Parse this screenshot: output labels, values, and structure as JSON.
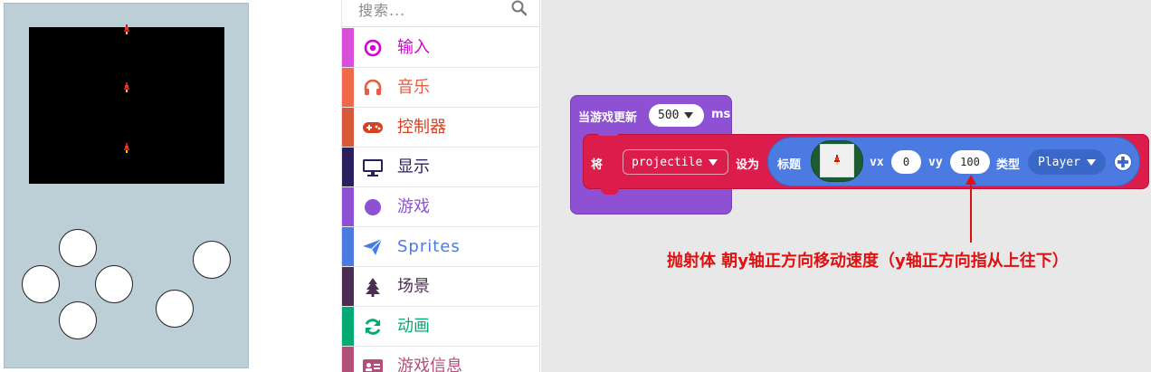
{
  "simulator": {
    "colors": {
      "screen": "#000000",
      "device": "#bccfd7"
    },
    "sprites": [
      {
        "icon": "rocket-sprite-icon"
      },
      {
        "icon": "rocket-sprite-icon"
      },
      {
        "icon": "rocket-sprite-icon"
      }
    ],
    "buttons": [
      "up",
      "left",
      "right",
      "down",
      "a",
      "b"
    ]
  },
  "toolbox": {
    "search_placeholder": "搜索...",
    "search_icon": "search-icon",
    "categories": [
      {
        "label": "输入",
        "color": "#d400d4",
        "icon": "target-icon"
      },
      {
        "label": "音乐",
        "color": "#e65c40",
        "icon": "headphones-icon"
      },
      {
        "label": "控制器",
        "color": "#d54322",
        "icon": "gamepad-icon"
      },
      {
        "label": "显示",
        "color": "#2b1f5e",
        "icon": "monitor-icon"
      },
      {
        "label": "游戏",
        "color": "#8f51d4",
        "icon": "circle-icon"
      },
      {
        "label": "Sprites",
        "color": "#4b7be0",
        "icon": "paper-plane-icon"
      },
      {
        "label": "场景",
        "color": "#4b2c52",
        "icon": "tree-icon"
      },
      {
        "label": "动画",
        "color": "#03aa74",
        "icon": "refresh-icon"
      },
      {
        "label": "游戏信息",
        "color": "#b34e78",
        "icon": "id-card-icon"
      }
    ]
  },
  "workspace": {
    "event_block": {
      "label": "当游戏更新",
      "interval": "500",
      "unit": "ms",
      "color": "#8f51d4"
    },
    "set_block": {
      "set_word": "将",
      "variable": "projectile",
      "to_word": "设为",
      "color": "#dc1d4c",
      "create_sprite": {
        "title_word": "标题",
        "vx_label": "vx",
        "vx": "0",
        "vy_label": "vy",
        "vy": "100",
        "kind_word": "类型",
        "kind": "Player",
        "color": "#4b7be0",
        "add_icon": "plus-circle-icon"
      }
    },
    "annotation": "抛射体 朝y轴正方向移动速度（y轴正方向指从上往下）",
    "annotation_color": "#e01010"
  }
}
